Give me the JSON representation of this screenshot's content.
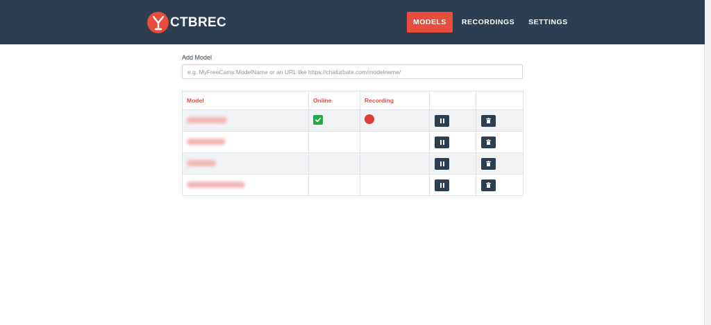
{
  "app": {
    "brand": "CTBREC",
    "colors": {
      "header_bg": "#2c3e50",
      "accent": "#e74c3c",
      "online": "#28a745"
    }
  },
  "nav": {
    "items": [
      {
        "label": "MODELS",
        "active": true
      },
      {
        "label": "RECORDINGS",
        "active": false
      },
      {
        "label": "SETTINGS",
        "active": false
      }
    ]
  },
  "add_model": {
    "label": "Add Model",
    "placeholder": "e.g. MyFreeCams:ModelName or an URL like https://chaturbate.com/modelname/",
    "value": ""
  },
  "table": {
    "headers": [
      "Model",
      "Online",
      "Recording",
      "",
      ""
    ],
    "rows": [
      {
        "model_name": "",
        "online": true,
        "recording": true
      },
      {
        "model_name": "",
        "online": false,
        "recording": false
      },
      {
        "model_name": "",
        "online": false,
        "recording": false
      },
      {
        "model_name": "",
        "online": false,
        "recording": false
      }
    ],
    "row_actions": {
      "pause_icon": "pause-icon",
      "delete_icon": "trash-icon"
    }
  }
}
